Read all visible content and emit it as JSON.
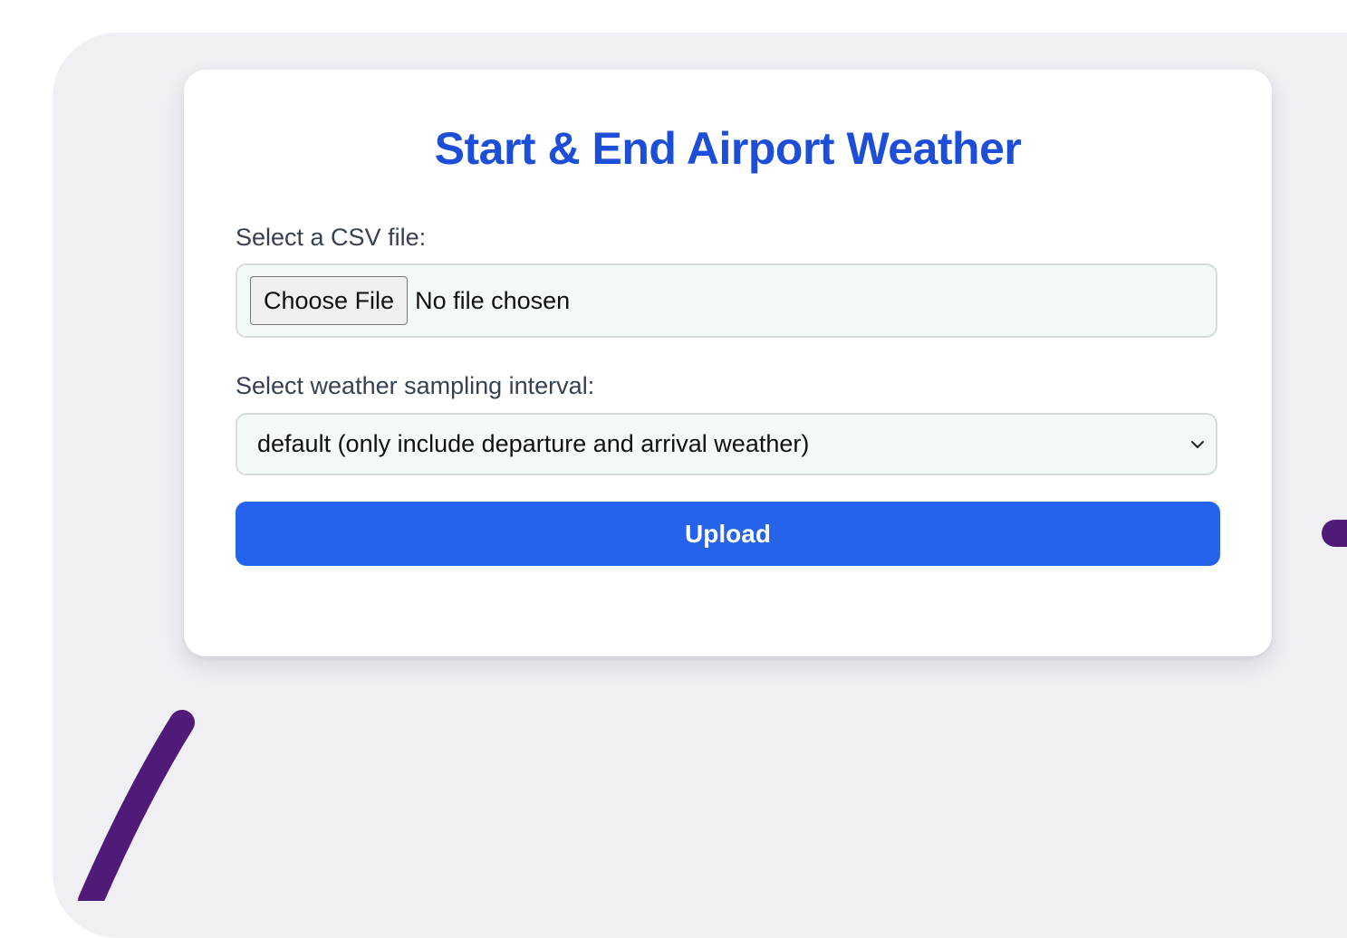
{
  "page": {
    "title": "Start & End Airport Weather"
  },
  "form": {
    "file_label": "Select a CSV file:",
    "file_button_label": "Choose File",
    "file_status": "No file chosen",
    "interval_label": "Select weather sampling interval:",
    "interval_selected": "default (only include departure and arrival weather)",
    "upload_label": "Upload"
  },
  "icons": {
    "select_chevron": "chevron-down-icon"
  },
  "colors": {
    "title": "#1d4ed8",
    "primary_button": "#2563eb",
    "decoration_stroke": "#4f1a78",
    "backdrop": "#f0eff4"
  }
}
